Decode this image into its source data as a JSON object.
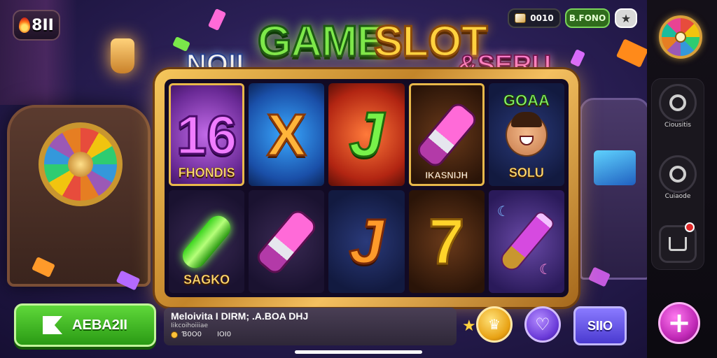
{
  "header": {
    "logo_text": "8II",
    "title_left": "NOII",
    "title_main_1": "GAME",
    "title_main_2": "SLOT",
    "title_right": "&SERU",
    "coins_value": "0010",
    "bonus_label": "B.FONO",
    "star_icon": "★"
  },
  "reels": {
    "cells": [
      {
        "symbol": "16",
        "label": "FHONDIS"
      },
      {
        "symbol": "X",
        "label": ""
      },
      {
        "symbol": "J",
        "label": ""
      },
      {
        "symbol": "",
        "label": "IKASNIJH"
      },
      {
        "symbol": "",
        "label_top": "GOAA",
        "label": "SOLU"
      },
      {
        "symbol": "",
        "label": "SAGKO"
      },
      {
        "symbol": "",
        "label": ""
      },
      {
        "symbol": "J",
        "label": ""
      },
      {
        "symbol": "7",
        "label": ""
      },
      {
        "symbol": "",
        "label": ""
      }
    ]
  },
  "sidebar": {
    "item1_label": "Ciousitis",
    "item2_label": "Cuiaode",
    "plus_label": "+"
  },
  "bottom": {
    "play_label": "AEBA2II",
    "info_title": "Meloivita I DIRM; .A.BOA DHJ",
    "info_sub": "Iikcoihoiiiae",
    "info_value_1": "Ɓ0O0",
    "info_value_2": "IOI0",
    "spin_label": "SIIO"
  },
  "colors": {
    "play_button": "#3fbf22",
    "spin_button": "#6a5af0",
    "gold_button": "#f2b824",
    "plus_button": "#d63ad0"
  }
}
